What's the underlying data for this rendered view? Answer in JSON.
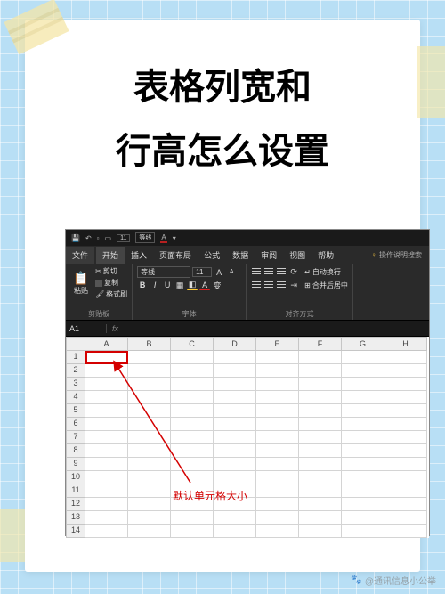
{
  "title_line1": "表格列宽和",
  "title_line2": "行高怎么设置",
  "qat": {
    "font_size": "11",
    "font_name": "等线"
  },
  "tabs": {
    "file": "文件",
    "items": [
      "开始",
      "插入",
      "页面布局",
      "公式",
      "数据",
      "审阅",
      "视图",
      "帮助"
    ],
    "active_index": 0,
    "search": "操作说明搜索"
  },
  "clipboard": {
    "paste": "粘贴",
    "cut": "剪切",
    "copy": "复制",
    "format_painter": "格式刷",
    "group_label": "剪贴板"
  },
  "font": {
    "name": "等线",
    "size": "11",
    "group_label": "字体"
  },
  "alignment": {
    "wrap": "自动换行",
    "merge": "合并后居中",
    "group_label": "对齐方式"
  },
  "name_box": "A1",
  "columns": [
    "A",
    "B",
    "C",
    "D",
    "E",
    "F",
    "G",
    "H"
  ],
  "rows": [
    "1",
    "2",
    "3",
    "4",
    "5",
    "6",
    "7",
    "8",
    "9",
    "10",
    "11",
    "12",
    "13",
    "14"
  ],
  "annotation": "默认单元格大小",
  "watermark": "@通讯信息小公举"
}
